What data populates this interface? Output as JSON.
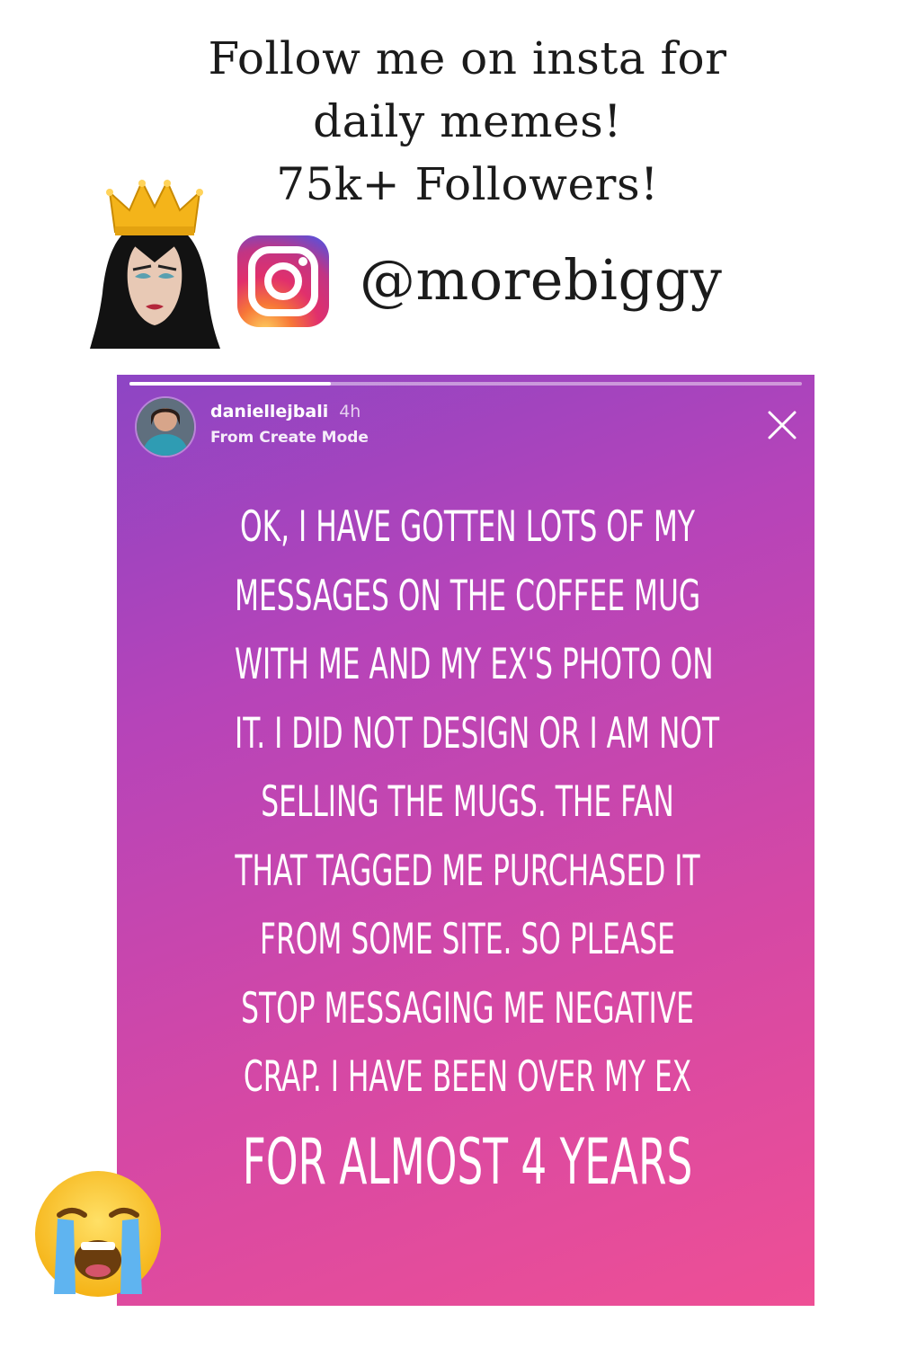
{
  "promo": {
    "lines": [
      "Follow me on insta for",
      "daily memes!",
      "75k+ Followers!"
    ]
  },
  "instagram": {
    "handle": "@morebiggy",
    "logo_icon": "instagram-icon"
  },
  "story": {
    "username": "daniellejbali",
    "time_ago": "4h",
    "subtitle": "From Create Mode",
    "progress": 0.3,
    "text_lines": [
      "OK, I HAVE GOTTEN LOTS OF MY",
      "MESSAGES ON THE COFFEE MUG",
      "WITH ME AND MY EX'S PHOTO ON",
      "IT. I DID NOT DESIGN OR I AM NOT",
      "SELLING THE MUGS. THE FAN",
      "THAT TAGGED ME PURCHASED IT",
      "FROM SOME SITE. SO PLEASE",
      "STOP MESSAGING ME NEGATIVE",
      "CRAP. I HAVE BEEN OVER MY EX"
    ],
    "final_line": "FOR ALMOST 4 YEARS",
    "close_icon": "close-icon"
  },
  "emojis": {
    "top_left": "evil-queen-emoji",
    "bottom_left": "loudly-crying-face-emoji"
  },
  "colors": {
    "gradient_top": "#8d45c4",
    "gradient_bottom": "#ee4f95",
    "text": "#ffffff"
  }
}
